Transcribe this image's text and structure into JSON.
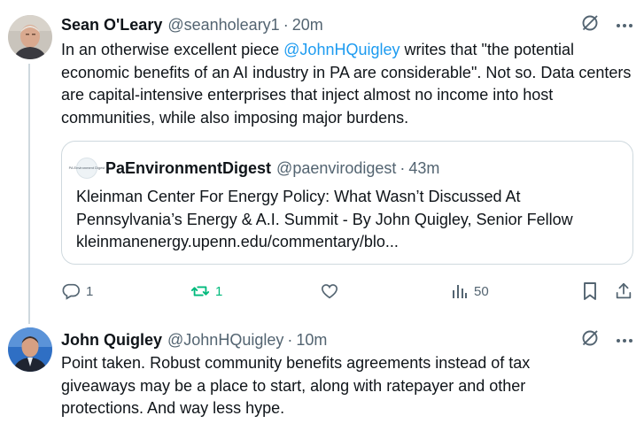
{
  "tweet1": {
    "name": "Sean O'Leary",
    "handle": "@seanholeary1",
    "separator": "·",
    "time": "20m",
    "text_line1_pre": "In an otherwise excellent piece ",
    "text_mention": "@JohnHQuigley",
    "text_line1_post": " writes that \"the potential",
    "text_rest": "economic benefits of an AI industry in PA are considerable\". Not so. Data centers are capital-intensive enterprises that inject almost no income into host communities, while also imposing major burdens.",
    "quote": {
      "avatar_text": "PA Environment Digest",
      "name": "PaEnvironmentDigest",
      "handle": "@paenvirodigest",
      "separator": "·",
      "time": "43m",
      "line1": "Kleinman Center For Energy Policy: What Wasn’t Discussed At",
      "line2": "Pennsylvania’s Energy & A.I. Summit - By John Quigley, Senior Fellow",
      "line3": "kleinmanenergy.upenn.edu/commentary/blo..."
    },
    "actions": {
      "replies": "1",
      "retweets": "1",
      "views": "50"
    }
  },
  "tweet2": {
    "name": "John Quigley",
    "handle": "@JohnHQuigley",
    "separator": "·",
    "time": "10m",
    "text": "Point taken. Robust community benefits agreements instead of tax giveaways may be a place to start, along with ratepayer and other protections. And way less hype."
  },
  "colors": {
    "accent": "#1d9bf0",
    "muted": "#536471",
    "retweet": "#00ba7c",
    "border": "#cfd9de"
  }
}
